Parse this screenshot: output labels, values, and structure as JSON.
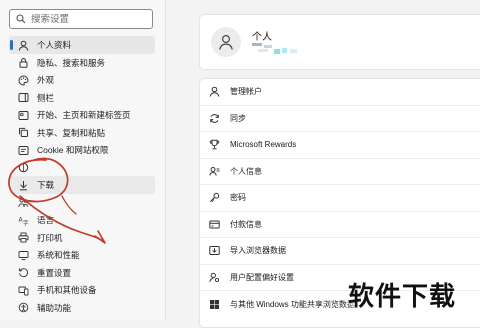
{
  "search": {
    "placeholder": "搜索设置"
  },
  "sidebar": {
    "items": [
      {
        "label": "个人资料",
        "icon": "person-icon"
      },
      {
        "label": "隐私、搜索和服务",
        "icon": "lock-icon"
      },
      {
        "label": "外观",
        "icon": "palette-icon"
      },
      {
        "label": "侧栏",
        "icon": "sidebar-icon"
      },
      {
        "label": "开始、主页和新建标签页",
        "icon": "home-icon"
      },
      {
        "label": "共享、复制和粘贴",
        "icon": "share-icon"
      },
      {
        "label": "Cookie 和网站权限",
        "icon": "cookie-icon"
      },
      {
        "label": "",
        "icon": "browser-icon"
      },
      {
        "label": "下载",
        "icon": "download-icon"
      },
      {
        "label": "",
        "icon": "family-icon"
      },
      {
        "label": "语言",
        "icon": "language-icon"
      },
      {
        "label": "打印机",
        "icon": "printer-icon"
      },
      {
        "label": "系统和性能",
        "icon": "system-icon"
      },
      {
        "label": "重置设置",
        "icon": "reset-icon"
      },
      {
        "label": "手机和其他设备",
        "icon": "phone-icon"
      },
      {
        "label": "辅助功能",
        "icon": "accessibility-icon"
      }
    ]
  },
  "profile": {
    "name": "个人"
  },
  "settings": {
    "rows": [
      {
        "label": "管理帐户",
        "icon": "person-icon"
      },
      {
        "label": "同步",
        "icon": "sync-icon"
      },
      {
        "label": "Microsoft Rewards",
        "icon": "trophy-icon"
      },
      {
        "label": "个人信息",
        "icon": "id-card-icon"
      },
      {
        "label": "密码",
        "icon": "key-icon"
      },
      {
        "label": "付款信息",
        "icon": "credit-card-icon"
      },
      {
        "label": "导入浏览器数据",
        "icon": "import-icon"
      },
      {
        "label": "用户配置偏好设置",
        "icon": "profile-settings-icon"
      },
      {
        "label": "与其他 Windows 功能共享浏览数据",
        "icon": "windows-icon"
      }
    ]
  },
  "watermark": {
    "text": "软件下载"
  },
  "colors": {
    "accent": "#2f6fb5",
    "annotation": "#c0392b"
  }
}
